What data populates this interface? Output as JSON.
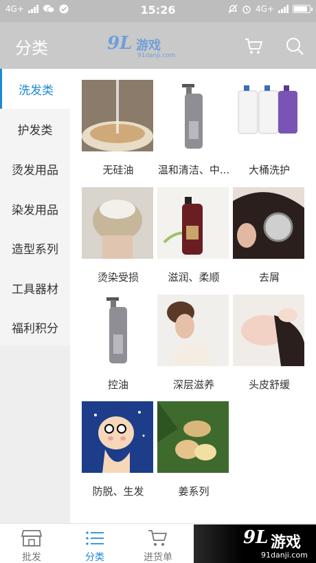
{
  "status": {
    "network_left": "4G+",
    "time": "15:26",
    "network_right": "4G+"
  },
  "header": {
    "title": "分类",
    "logo_number": "9L",
    "logo_text": "游戏",
    "logo_url": "91danji.com",
    "icons": [
      "cart-icon",
      "search-icon"
    ]
  },
  "sidebar": {
    "items": [
      {
        "label": "洗发类",
        "active": true
      },
      {
        "label": "护发类"
      },
      {
        "label": "烫发用品"
      },
      {
        "label": "染发用品"
      },
      {
        "label": "造型系列"
      },
      {
        "label": "工具器材"
      },
      {
        "label": "福利积分"
      }
    ]
  },
  "products": [
    {
      "label": "无硅油"
    },
    {
      "label": "温和清洁、中..."
    },
    {
      "label": "大桶洗护"
    },
    {
      "label": "烫染受损"
    },
    {
      "label": "滋润、柔顺"
    },
    {
      "label": "去屑"
    },
    {
      "label": "控油"
    },
    {
      "label": "深层滋养"
    },
    {
      "label": "头皮舒缓"
    },
    {
      "label": "防脱、生发"
    },
    {
      "label": "姜系列"
    }
  ],
  "tabbar": {
    "tabs": [
      {
        "label": "批发",
        "icon": "store-icon"
      },
      {
        "label": "分类",
        "icon": "list-icon",
        "active": true
      },
      {
        "label": "进货单",
        "icon": "cart-icon"
      }
    ]
  },
  "watermark": {
    "number": "9L",
    "text": "游戏",
    "url": "91danji.com"
  },
  "colors": {
    "accent": "#1e88d8",
    "header_bg": "#c9c9c9"
  }
}
